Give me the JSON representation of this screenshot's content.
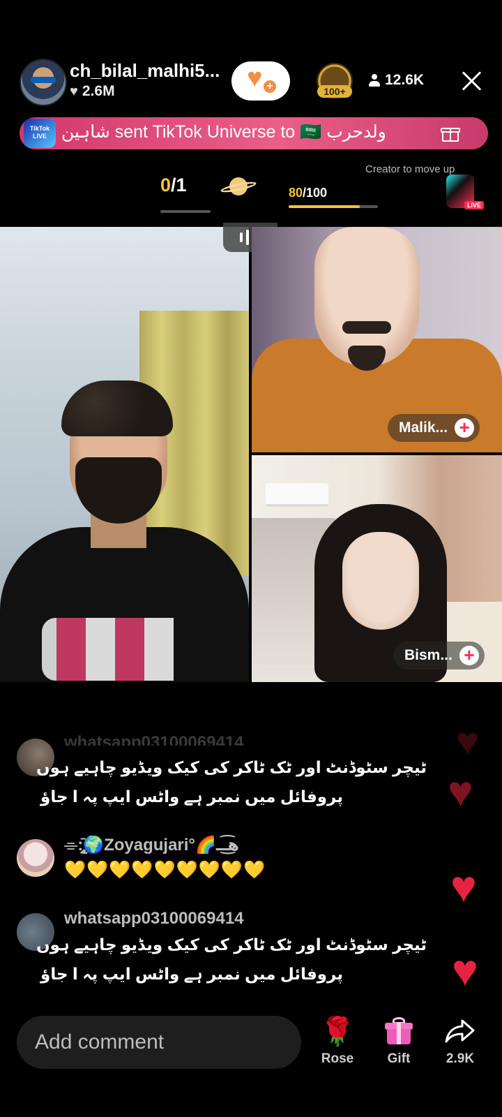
{
  "header": {
    "host_name": "ch_bilal_malhi5...",
    "host_likes": "2.6M",
    "top_gifter_badge": "100+",
    "viewer_count": "12.6K"
  },
  "banner": {
    "logo_text": "TikTok LIVE",
    "message": "شاہین sent TikTok Universe to 🇸🇦 ولدحرب"
  },
  "match": {
    "count_done": "0",
    "count_total": "/1",
    "progress_current": "80",
    "progress_total": "/100",
    "progress_fraction": 0.8,
    "creator_tip": "Creator to move up"
  },
  "live_badge": "LIVE",
  "guests": [
    {
      "name": "Malik..."
    },
    {
      "name": "Bism..."
    }
  ],
  "comments": {
    "faded_top": "whatsapp03100069414",
    "items": [
      {
        "user": "",
        "lines": [
          "ٹیچر سٹوڈنٹ اور ٹک ٹاکر کی کیک ویڈیو چاہیے ہوں",
          "پروفائل میں نمبر ہے واٹس ایپ پہ ا جاؤ"
        ]
      },
      {
        "user": "⌯⁠:̨̢̤̄🌍Zoyagujari°🌈ه͜͡ــ",
        "lines": [
          "💛💛💛💛💛💛💛💛💛"
        ]
      },
      {
        "user": "whatsapp03100069414",
        "lines": [
          "ٹیچر سٹوڈنٹ اور ٹک ٹاکر کی کیک ویڈیو چاہیے ہوں",
          "پروفائل میں نمبر ہے واٹس ایپ پہ ا جاؤ"
        ]
      }
    ]
  },
  "bottom_bar": {
    "comment_placeholder": "Add comment",
    "rose_label": "Rose",
    "gift_label": "Gift",
    "share_count": "2.9K"
  },
  "colors": {
    "accent_yellow": "#f5c43a",
    "banner_pink": "#e04f7e",
    "heart_red": "#e8233f",
    "follow_orange": "#f08f4a"
  }
}
